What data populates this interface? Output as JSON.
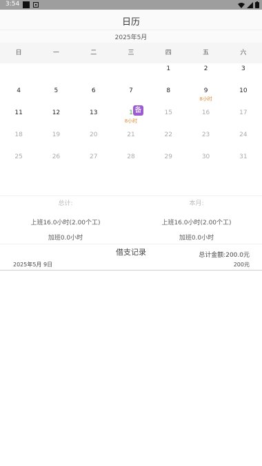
{
  "status": {
    "time": "3:54"
  },
  "app": {
    "title": "日历"
  },
  "calendar": {
    "month_label": "2025年5月",
    "weekdays": [
      "日",
      "一",
      "二",
      "三",
      "四",
      "五",
      "六"
    ],
    "days": [
      {
        "n": "",
        "gray": false
      },
      {
        "n": "",
        "gray": false
      },
      {
        "n": "",
        "gray": false
      },
      {
        "n": "",
        "gray": false
      },
      {
        "n": "1",
        "gray": false
      },
      {
        "n": "2",
        "gray": false
      },
      {
        "n": "3",
        "gray": false
      },
      {
        "n": "4",
        "gray": false
      },
      {
        "n": "5",
        "gray": false
      },
      {
        "n": "6",
        "gray": false
      },
      {
        "n": "7",
        "gray": false
      },
      {
        "n": "8",
        "gray": false
      },
      {
        "n": "9",
        "gray": false,
        "hours": "8小时"
      },
      {
        "n": "10",
        "gray": false
      },
      {
        "n": "11",
        "gray": false
      },
      {
        "n": "12",
        "gray": false
      },
      {
        "n": "13",
        "gray": false
      },
      {
        "n": "1",
        "gray": false,
        "today": true,
        "hours": "8小时",
        "badge": "备"
      },
      {
        "n": "15",
        "gray": true
      },
      {
        "n": "16",
        "gray": true
      },
      {
        "n": "17",
        "gray": true
      },
      {
        "n": "18",
        "gray": true
      },
      {
        "n": "19",
        "gray": true
      },
      {
        "n": "20",
        "gray": true
      },
      {
        "n": "21",
        "gray": true
      },
      {
        "n": "22",
        "gray": true
      },
      {
        "n": "23",
        "gray": true
      },
      {
        "n": "24",
        "gray": true
      },
      {
        "n": "25",
        "gray": true
      },
      {
        "n": "26",
        "gray": true
      },
      {
        "n": "27",
        "gray": true
      },
      {
        "n": "28",
        "gray": true
      },
      {
        "n": "29",
        "gray": true
      },
      {
        "n": "30",
        "gray": true
      },
      {
        "n": "31",
        "gray": true
      }
    ]
  },
  "summary": {
    "total": {
      "header": "总计:",
      "work": "上班16.0小时(2.00个工)",
      "overtime": "加班0.0小时"
    },
    "month": {
      "header": "本月:",
      "work": "上班16.0小时(2.00个工)",
      "overtime": "加班0.0小时"
    }
  },
  "loan": {
    "title": "借支记录",
    "total": "总计金额:200.0元",
    "records": [
      {
        "date": "2025年5月 9日",
        "amount": "200元"
      }
    ]
  }
}
